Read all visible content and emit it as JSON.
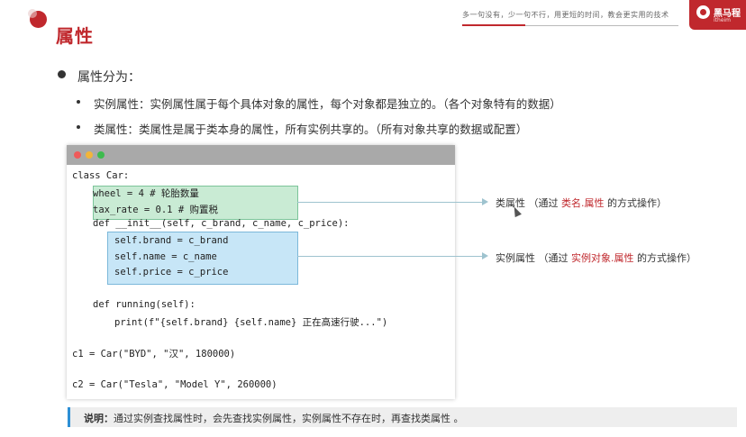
{
  "header": {
    "title": "属性",
    "slogan": "多一句没有，少一句不行，用更短的时间，教会更实用的技术",
    "logo_text": "黑马程",
    "logo_sub": "itheim"
  },
  "content": {
    "main_bullet": "属性分为：",
    "sub_bullets": [
      "实例属性：实例属性属于每个具体对象的属性，每个对象都是独立的。（各个对象特有的数据）",
      "类属性：类属性是属于类本身的属性，所有实例共享的。（所有对象共享的数据或配置）"
    ]
  },
  "code": {
    "lines": [
      "class Car:",
      "wheel = 4 # 轮胎数量",
      "tax_rate = 0.1 # 购置税",
      "def __init__(self, c_brand, c_name, c_price):",
      "self.brand = c_brand",
      "self.name = c_name",
      "self.price = c_price",
      "def running(self):",
      "print(f\"{self.brand} {self.name} 正在高速行驶...\")",
      "c1 = Car(\"BYD\", \"汉\", 180000)",
      "c2 = Car(\"Tesla\", \"Model Y\", 260000)"
    ]
  },
  "annotations": {
    "class_attr": {
      "prefix": "类属性 （通过 ",
      "highlight": "类名.属性",
      "suffix": " 的方式操作）"
    },
    "instance_attr": {
      "prefix": "实例属性 （通过 ",
      "highlight": "实例对象.属性",
      "suffix": " 的方式操作）"
    }
  },
  "note": {
    "label": "说明：",
    "text": "通过实例查找属性时，会先查找实例属性，实例属性不存在时，再查找类属性 。"
  },
  "colors": {
    "accent": "#c0282d",
    "class_box": "#c9ebd4",
    "instance_box": "#c7e6f7",
    "note_border": "#2d8fd5"
  }
}
